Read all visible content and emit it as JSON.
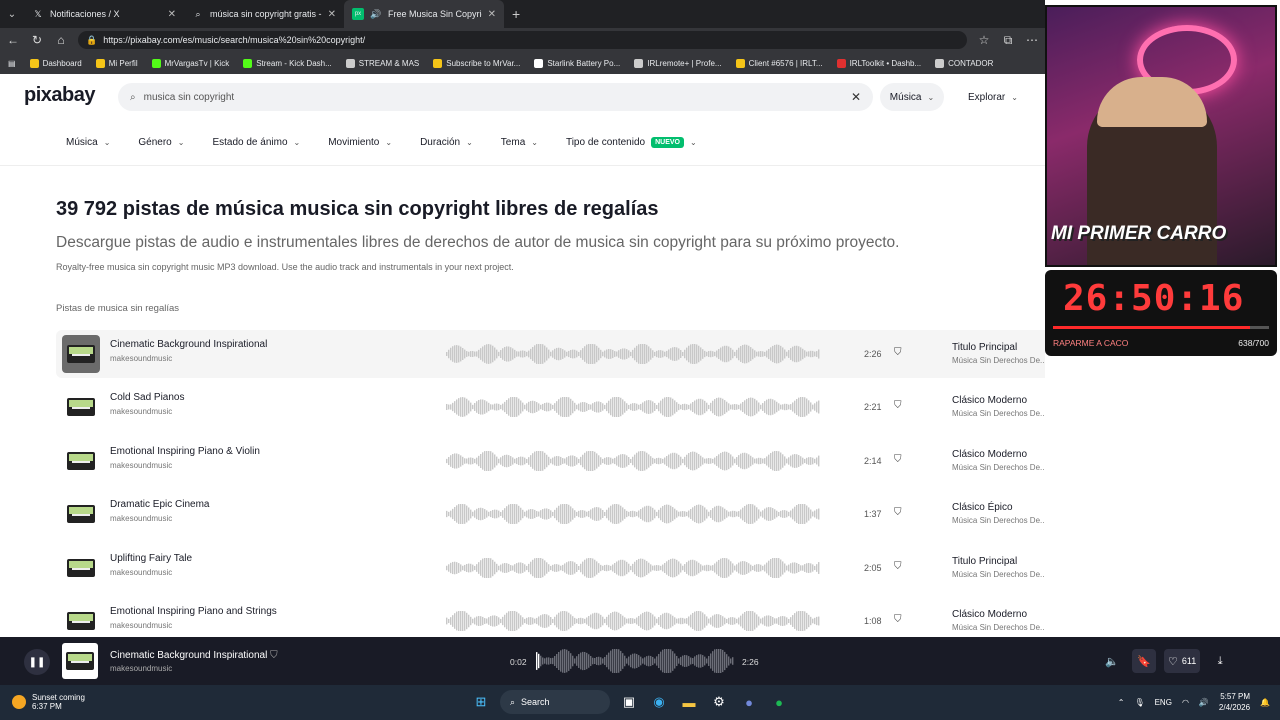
{
  "browser": {
    "tabs": [
      {
        "label": "Notificaciones / X",
        "icon": "x-logo-icon",
        "active": false
      },
      {
        "label": "música sin copyright gratis - Búsq",
        "icon": "search-icon",
        "active": false
      },
      {
        "label": "Free Musica Sin Copyright M",
        "icon": "pixabay-icon",
        "active": true
      }
    ],
    "url": "https://pixabay.com/es/music/search/musica%20sin%20copyright/",
    "bookmarks": [
      {
        "label": "Dashboard",
        "color": "#f5c518"
      },
      {
        "label": "Mi Perfil",
        "color": "#f5c518"
      },
      {
        "label": "MrVargasTv | Kick",
        "color": "#53fc18"
      },
      {
        "label": "Stream - Kick Dash...",
        "color": "#53fc18"
      },
      {
        "label": "STREAM & MAS",
        "color": "#cccccc"
      },
      {
        "label": "Subscribe to MrVar...",
        "color": "#f5c518"
      },
      {
        "label": "Starlink Battery Po...",
        "color": "#ffffff"
      },
      {
        "label": "IRLremote+ | Profe...",
        "color": "#cccccc"
      },
      {
        "label": "Client #6576 | IRLT...",
        "color": "#f5c518"
      },
      {
        "label": "IRLToolkit • Dashb...",
        "color": "#e03030"
      },
      {
        "label": "CONTADOR",
        "color": "#cccccc"
      }
    ]
  },
  "site": {
    "logo": "pixabay",
    "search_query": "musica sin copyright",
    "category": "Música",
    "explore": "Explorar",
    "filters": [
      {
        "label": "Música"
      },
      {
        "label": "Género"
      },
      {
        "label": "Estado de ánimo"
      },
      {
        "label": "Movimiento"
      },
      {
        "label": "Duración"
      },
      {
        "label": "Tema"
      },
      {
        "label": "Tipo de contenido",
        "badge": "NUEVO"
      }
    ],
    "heading": "39 792 pistas de música musica sin copyright libres de regalías",
    "subheading": "Descargue pistas de audio e instrumentales libres de derechos de autor de musica sin copyright para su próximo proyecto.",
    "description": "Royalty-free musica sin copyright music MP3 download. Use the audio track and instrumentals in your next project.",
    "section_label": "Pistas de musica sin regalías",
    "accent": "#02be6e"
  },
  "tracks": [
    {
      "title": "Cinematic Background Inspirational",
      "author": "makesoundmusic",
      "duration": "2:26",
      "genre": "Titulo Principal",
      "subgenre": "Música Sin Derechos De...",
      "playing": true
    },
    {
      "title": "Cold Sad Pianos",
      "author": "makesoundmusic",
      "duration": "2:21",
      "genre": "Clásico Moderno",
      "subgenre": "Música Sin Derechos De...",
      "playing": false
    },
    {
      "title": "Emotional Inspiring Piano & Violin",
      "author": "makesoundmusic",
      "duration": "2:14",
      "genre": "Clásico Moderno",
      "subgenre": "Música Sin Derechos De...",
      "playing": false
    },
    {
      "title": "Dramatic Epic Cinema",
      "author": "makesoundmusic",
      "duration": "1:37",
      "genre": "Clásico Épico",
      "subgenre": "Música Sin Derechos De...",
      "playing": false
    },
    {
      "title": "Uplifting Fairy Tale",
      "author": "makesoundmusic",
      "duration": "2:05",
      "genre": "Titulo Principal",
      "subgenre": "Música Sin Derechos De...",
      "playing": false
    },
    {
      "title": "Emotional Inspiring Piano and Strings",
      "author": "makesoundmusic",
      "duration": "1:08",
      "genre": "Clásico Moderno",
      "subgenre": "Música Sin Derechos De...",
      "playing": false
    }
  ],
  "player": {
    "title": "Cinematic Background Inspirational",
    "author": "makesoundmusic",
    "elapsed": "0:02",
    "total": "2:26",
    "progress": 0.014,
    "likes": "611"
  },
  "overlay": {
    "banner": "MI PRIMER CARRO",
    "timer": "26:50:16",
    "goal_label": "RAPARME A CACO",
    "goal_count": "638/700",
    "goal_progress": 0.911
  },
  "taskbar": {
    "weather_title": "Sunset coming",
    "weather_time": "6:37 PM",
    "search_label": "Search",
    "lang": "ENG",
    "time": "5:57 PM",
    "date": "2/4/2026"
  }
}
